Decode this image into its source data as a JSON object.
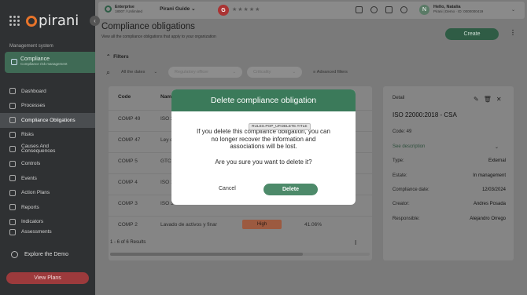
{
  "sidebar": {
    "brand": "pirani",
    "section_label": "Management system",
    "module": {
      "title": "Compliance",
      "subtitle": "Compliance risk management"
    },
    "items": [
      {
        "label": "Dashboard",
        "icon": "dashboard-icon"
      },
      {
        "label": "Processes",
        "icon": "processes-icon"
      },
      {
        "label": "Compliance Obligations",
        "icon": "obligations-icon",
        "active": true
      },
      {
        "label": "Risks",
        "icon": "risks-icon"
      },
      {
        "label": "Causes And Consequences",
        "icon": "causes-icon"
      },
      {
        "label": "Controls",
        "icon": "controls-icon"
      },
      {
        "label": "Events",
        "icon": "events-icon"
      },
      {
        "label": "Action Plans",
        "icon": "action-plans-icon"
      },
      {
        "label": "Reports",
        "icon": "reports-icon"
      },
      {
        "label": "Indicators",
        "icon": "indicators-icon"
      },
      {
        "label": "Assessments",
        "icon": "assessments-icon"
      }
    ],
    "explore": "Explore the Demo",
    "view_plans": "View Plans"
  },
  "topbar": {
    "plan_name": "Enterprise",
    "plan_detail": "18007 / Unlimited",
    "guide": "Pirani Guide",
    "stars": "★★★★★",
    "greeting": "Hello, Natalia",
    "org": "Pirani | Demo · ID: 0000000419",
    "avatar_initial": "N"
  },
  "page": {
    "title": "Compliance obligations",
    "subtitle": "View all the compliance obligations that apply to your organization",
    "create_label": "Create",
    "more": "⋮"
  },
  "filters": {
    "label": "Filters",
    "dates": "All the dates",
    "regulatory": "Regulatory officer",
    "criticality": "Criticality",
    "advanced": "Advanced filters"
  },
  "table": {
    "headers": [
      "Code",
      "Nam"
    ],
    "rows": [
      {
        "code": "COMP 49",
        "name": "ISO 2"
      },
      {
        "code": "COMP 47",
        "name": "Ley d"
      },
      {
        "code": "COMP 5",
        "name": "GTC-"
      },
      {
        "code": "COMP 4",
        "name": "ISO 1"
      },
      {
        "code": "COMP 3",
        "name": "ISO 3"
      },
      {
        "code": "COMP 2",
        "name": "Lavado de activos y finar",
        "criticality": "High",
        "percent": "41.06%"
      }
    ],
    "footer": "1 - 6 of 6 Results"
  },
  "detail": {
    "label": "Detail",
    "title": "ISO 22000:2018 - CSA",
    "code": "Code: 49",
    "see_description": "See description",
    "fields": [
      {
        "k": "Type:",
        "v": "External"
      },
      {
        "k": "Estate:",
        "v": "In management"
      },
      {
        "k": "Compliance date:",
        "v": "12/03/2024"
      },
      {
        "k": "Creator:",
        "v": "Andres Posada"
      },
      {
        "k": "Responsible:",
        "v": "Alejandro Orrego"
      }
    ]
  },
  "modal": {
    "title": "Delete compliance obligation",
    "tooltip": "RULES.POP_UP.DELETE.TITLE",
    "message": "If you delete this compliance obligation, you can no longer recover the information and associations will be lost.",
    "confirm": "Are you sure you want to delete it?",
    "cancel": "Cancel",
    "delete": "Delete"
  },
  "colors": {
    "brand_green": "#3b7a5a",
    "delete_button": "#4d8a6a",
    "view_plans": "#9c3a3c",
    "logo_orange": "#e8742a"
  }
}
